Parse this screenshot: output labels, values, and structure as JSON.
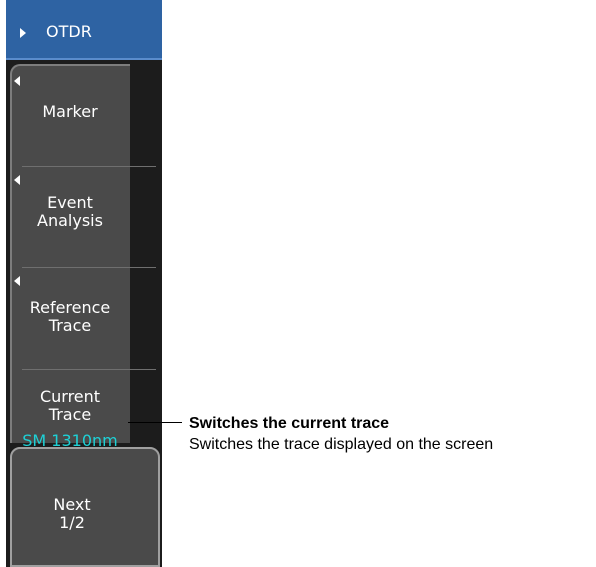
{
  "menu": {
    "title": "OTDR",
    "softkeys": [
      {
        "line1": "Marker",
        "line2": ""
      },
      {
        "line1": "Event",
        "line2": "Analysis"
      },
      {
        "line1": "Reference",
        "line2": "Trace"
      },
      {
        "line1": "Current",
        "line2": "Trace",
        "value": "SM 1310nm"
      }
    ],
    "next": {
      "line1": "Next",
      "line2": "1/2"
    }
  },
  "callout": {
    "title": "Switches the current trace",
    "description": "Switches the trace displayed on the screen"
  },
  "colors": {
    "header": "#2e63a3",
    "key_bg": "#4a4a4a",
    "value_text": "#1ed1d6"
  }
}
